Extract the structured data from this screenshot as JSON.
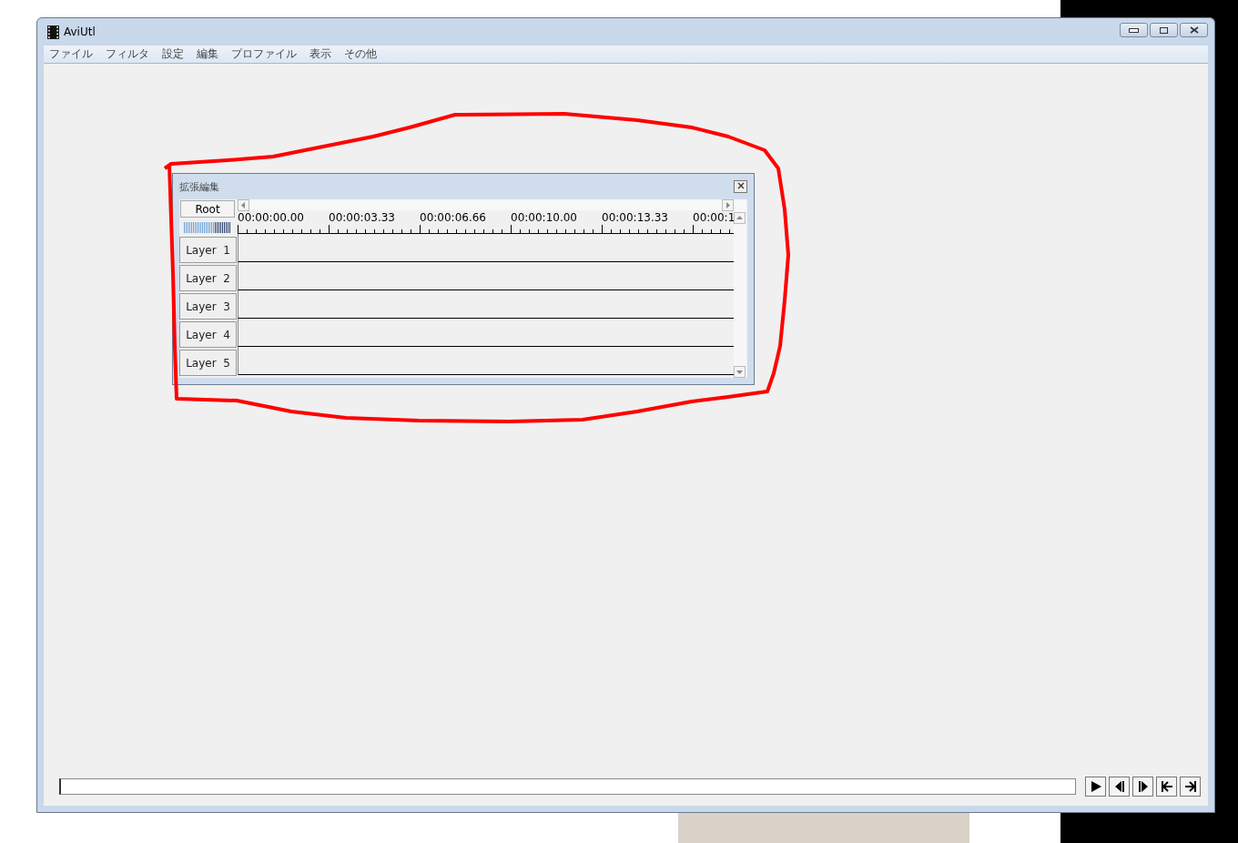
{
  "window": {
    "title": "AviUtl"
  },
  "menu": [
    "ファイル",
    "フィルタ",
    "設定",
    "編集",
    "プロファイル",
    "表示",
    "その他"
  ],
  "timeline_window": {
    "title": "拡張編集",
    "root_button": "Root",
    "time_labels": [
      "00:00:00.00",
      "00:00:03.33",
      "00:00:06.66",
      "00:00:10.00",
      "00:00:13.33",
      "00:00:1"
    ],
    "layers": [
      "Layer  1",
      "Layer  2",
      "Layer  3",
      "Layer  4",
      "Layer  5"
    ]
  }
}
